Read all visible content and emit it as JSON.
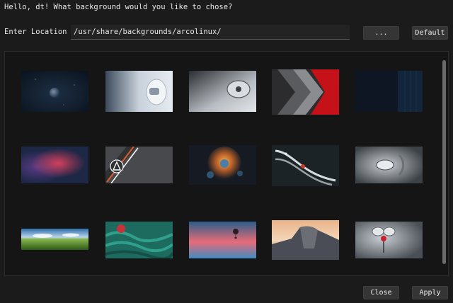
{
  "header": {
    "greeting": "Hello, dt! What background would you like to chose?"
  },
  "location": {
    "label": "Enter Location",
    "value": "/usr/share/backgrounds/arcolinux/"
  },
  "buttons": {
    "browse": "...",
    "default": "Default",
    "close": "Close",
    "apply": "Apply"
  },
  "gallery": {
    "thumbnails": [
      "earth-space-wallpaper",
      "white-robot-wallpaper",
      "silver-machine-wallpaper",
      "red-chevron-wallpaper",
      "dark-blue-wallpaper",
      "blur-bokeh-wallpaper",
      "arcolinux-logo-wallpaper",
      "fractal-flower-wallpaper",
      "dna-strand-wallpaper",
      "grey-drone-wallpaper",
      "green-landscape-wallpaper",
      "green-yarn-wallpaper",
      "sunset-balloon-wallpaper",
      "mountain-dome-wallpaper",
      "robot-bug-wallpaper"
    ]
  }
}
